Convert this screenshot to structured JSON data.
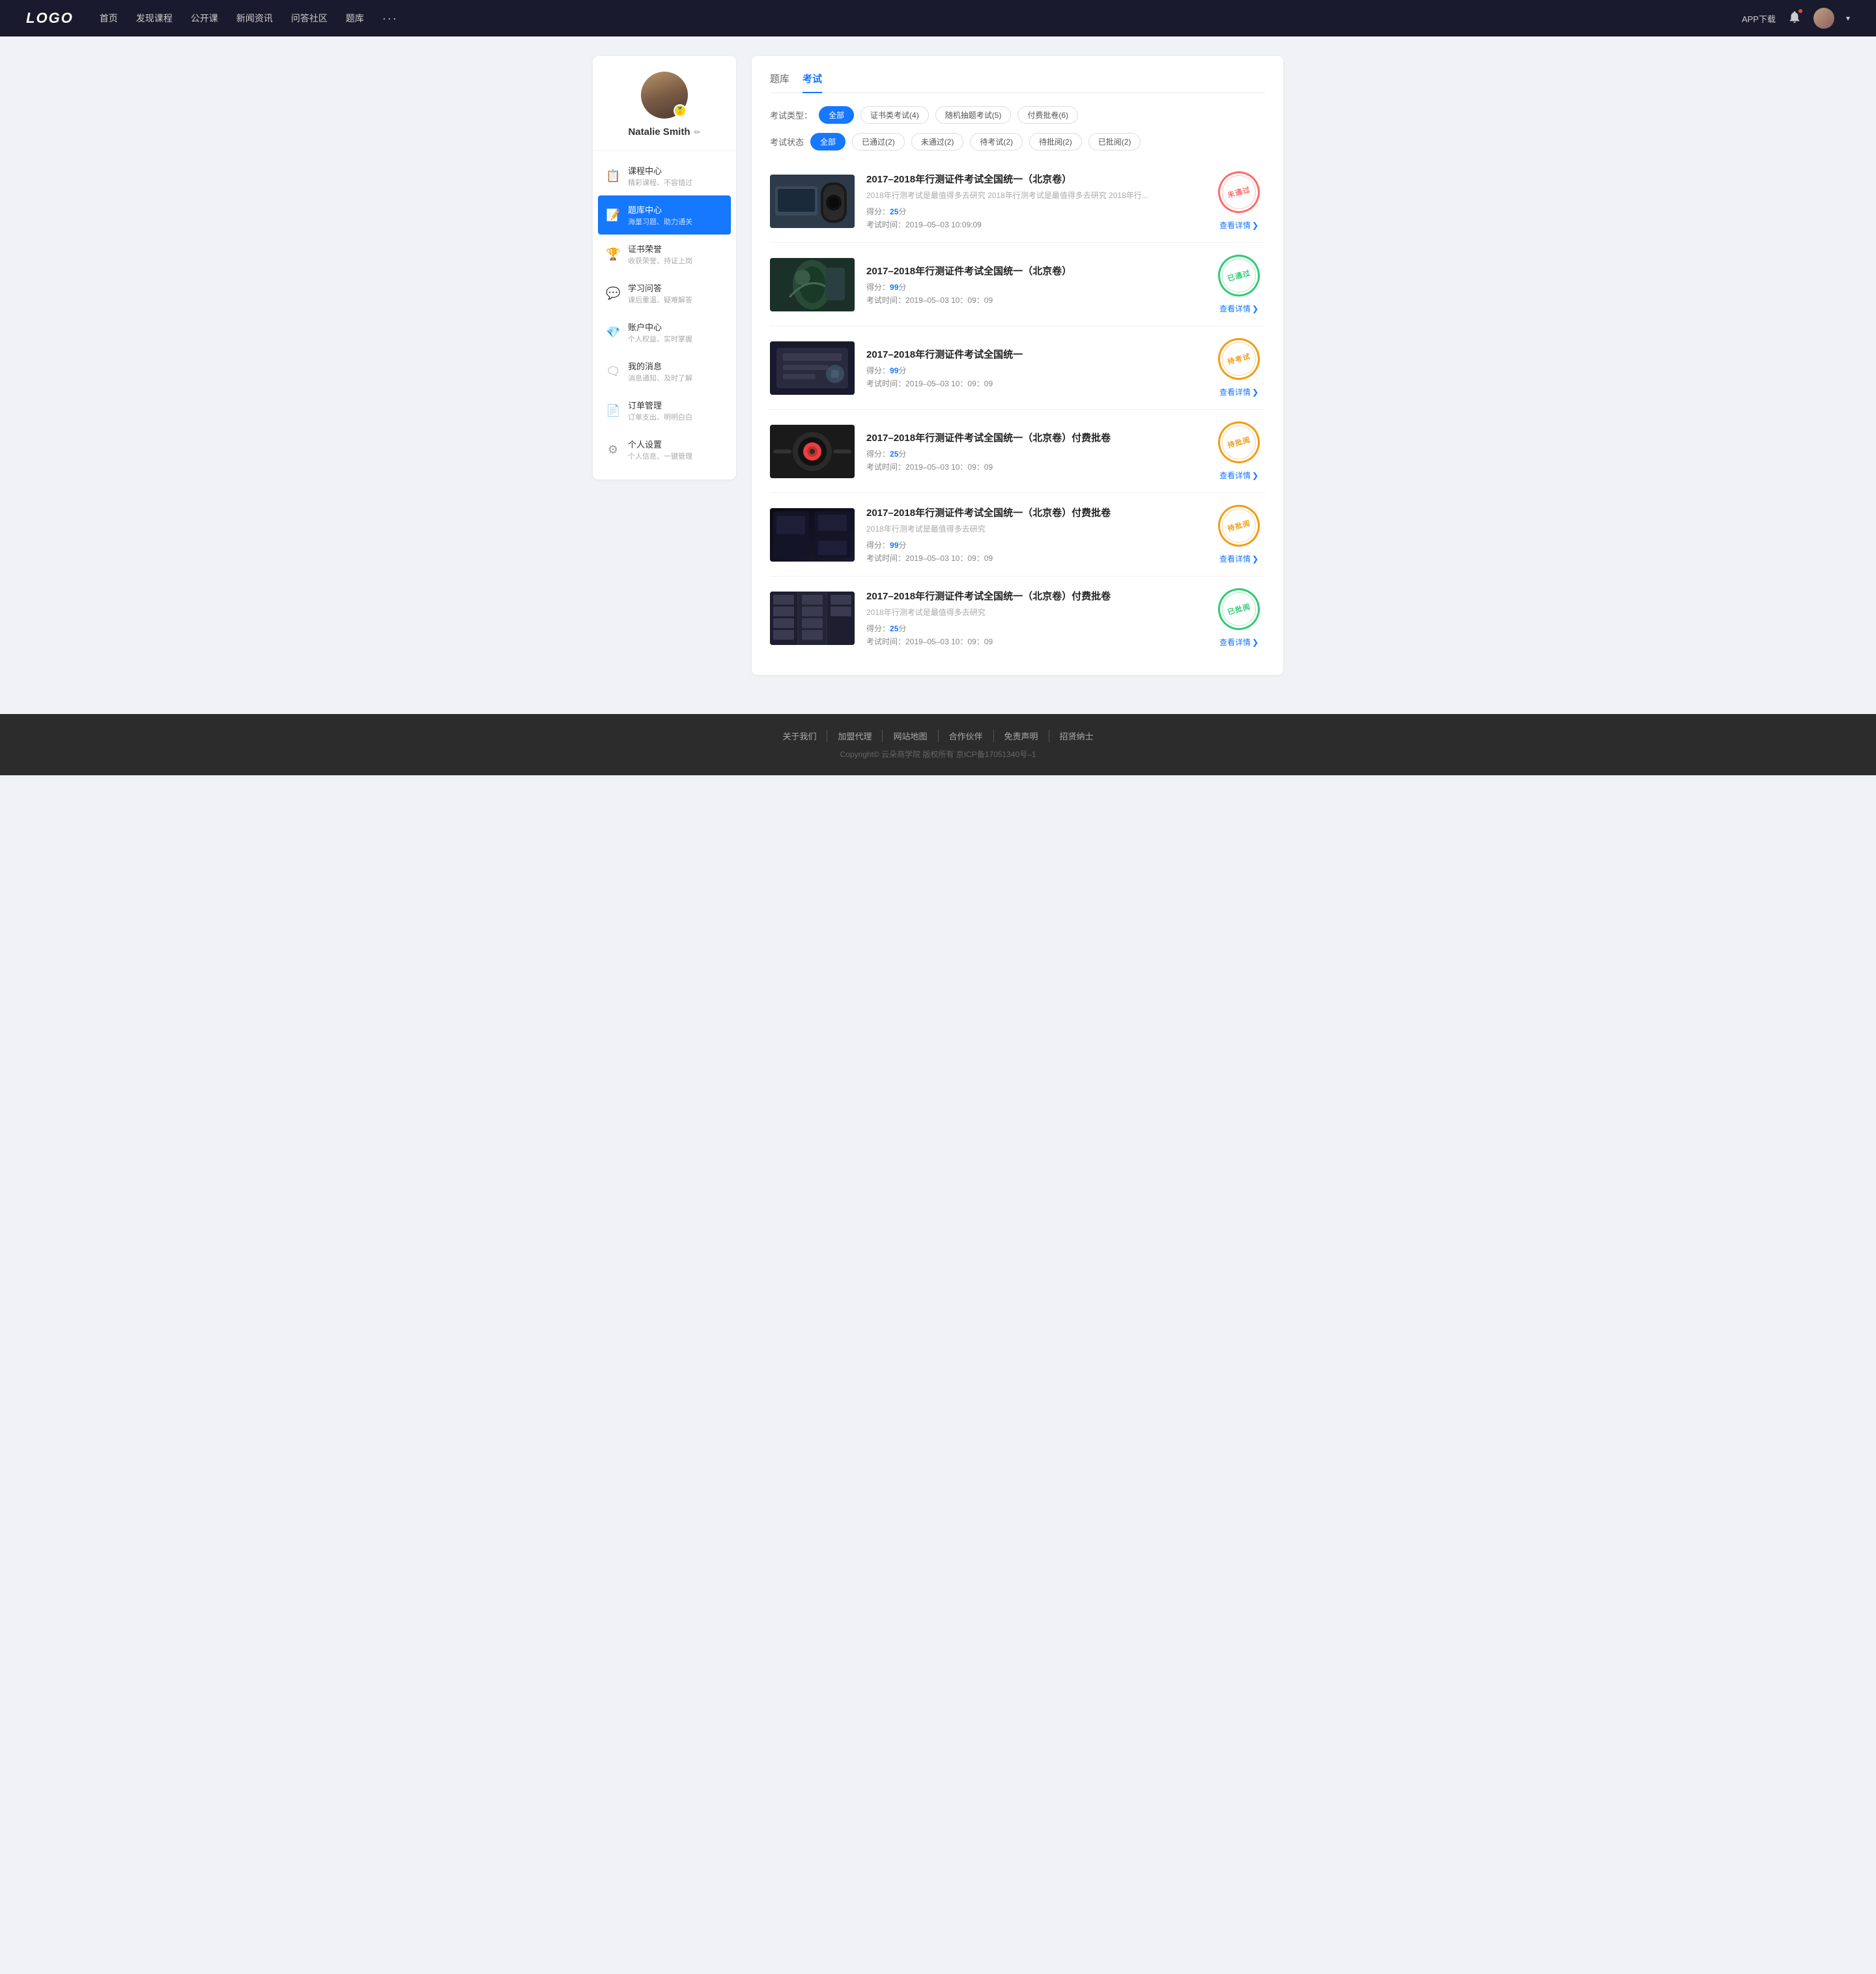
{
  "navbar": {
    "logo": "LOGO",
    "nav_items": [
      {
        "label": "首页",
        "key": "home"
      },
      {
        "label": "发现课程",
        "key": "discover"
      },
      {
        "label": "公开课",
        "key": "public"
      },
      {
        "label": "新闻资讯",
        "key": "news"
      },
      {
        "label": "问答社区",
        "key": "qa"
      },
      {
        "label": "题库",
        "key": "bank"
      },
      {
        "label": "···",
        "key": "more"
      }
    ],
    "app_download": "APP下载"
  },
  "sidebar": {
    "profile": {
      "name": "Natalie Smith",
      "badge": "🏅"
    },
    "menu_items": [
      {
        "key": "course",
        "icon": "📋",
        "title": "课程中心",
        "subtitle": "精彩课程、不容错过",
        "active": false
      },
      {
        "key": "bank",
        "icon": "📝",
        "title": "题库中心",
        "subtitle": "海量习题、助力通关",
        "active": true
      },
      {
        "key": "cert",
        "icon": "🏆",
        "title": "证书荣誉",
        "subtitle": "收获荣誉、持证上岗",
        "active": false
      },
      {
        "key": "qa",
        "icon": "💬",
        "title": "学习问答",
        "subtitle": "课后重温、疑难解答",
        "active": false
      },
      {
        "key": "account",
        "icon": "💎",
        "title": "账户中心",
        "subtitle": "个人权益、实时掌握",
        "active": false
      },
      {
        "key": "message",
        "icon": "🗨",
        "title": "我的消息",
        "subtitle": "消息通知、及时了解",
        "active": false
      },
      {
        "key": "order",
        "icon": "📄",
        "title": "订单管理",
        "subtitle": "订单支出、明明白白",
        "active": false
      },
      {
        "key": "settings",
        "icon": "⚙",
        "title": "个人设置",
        "subtitle": "个人信息、一键管理",
        "active": false
      }
    ]
  },
  "main": {
    "top_tabs": [
      {
        "label": "题库",
        "key": "bank",
        "active": false
      },
      {
        "label": "考试",
        "key": "exam",
        "active": true
      }
    ],
    "type_filter": {
      "label": "考试类型：",
      "options": [
        {
          "label": "全部",
          "key": "all",
          "active": true
        },
        {
          "label": "证书类考试(4)",
          "key": "cert",
          "active": false
        },
        {
          "label": "随机抽题考试(5)",
          "key": "random",
          "active": false
        },
        {
          "label": "付费批卷(6)",
          "key": "paid",
          "active": false
        }
      ]
    },
    "status_filter": {
      "label": "考试状态",
      "options": [
        {
          "label": "全部",
          "key": "all",
          "active": true
        },
        {
          "label": "已通过(2)",
          "key": "passed",
          "active": false
        },
        {
          "label": "未通过(2)",
          "key": "failed",
          "active": false
        },
        {
          "label": "待考试(2)",
          "key": "pending",
          "active": false
        },
        {
          "label": "待批阅(2)",
          "key": "review",
          "active": false
        },
        {
          "label": "已批阅(2)",
          "key": "reviewed",
          "active": false
        }
      ]
    },
    "exam_items": [
      {
        "id": 1,
        "title": "2017–2018年行测证件考试全国统一（北京卷）",
        "desc": "2018年行测考试是最值得多去研究 2018年行测考试是最值得多去研究 2018年行...",
        "score_label": "得分：",
        "score": "25",
        "score_suffix": "分",
        "time_label": "考试时间：",
        "time": "2019–05–03  10:09:09",
        "status": "not_passed",
        "status_text": "未通过",
        "view_label": "查看详情",
        "thumb_class": "thumb-1"
      },
      {
        "id": 2,
        "title": "2017–2018年行测证件考试全国统一（北京卷）",
        "desc": "",
        "score_label": "得分：",
        "score": "99",
        "score_suffix": "分",
        "time_label": "考试时间：",
        "time": "2019–05–03  10：09：09",
        "status": "passed",
        "status_text": "已通过",
        "view_label": "查看详情",
        "thumb_class": "thumb-2"
      },
      {
        "id": 3,
        "title": "2017–2018年行测证件考试全国统一",
        "desc": "",
        "score_label": "得分：",
        "score": "99",
        "score_suffix": "分",
        "time_label": "考试时间：",
        "time": "2019–05–03  10：09：09",
        "status": "pending",
        "status_text": "待考试",
        "view_label": "查看详情",
        "thumb_class": "thumb-3"
      },
      {
        "id": 4,
        "title": "2017–2018年行测证件考试全国统一（北京卷）付费批卷",
        "desc": "",
        "score_label": "得分：",
        "score": "25",
        "score_suffix": "分",
        "time_label": "考试时间：",
        "time": "2019–05–03  10：09：09",
        "status": "review",
        "status_text": "待批阅",
        "view_label": "查看详情",
        "thumb_class": "thumb-4"
      },
      {
        "id": 5,
        "title": "2017–2018年行测证件考试全国统一（北京卷）付费批卷",
        "desc": "2018年行测考试是最值得多去研究",
        "score_label": "得分：",
        "score": "99",
        "score_suffix": "分",
        "time_label": "考试时间：",
        "time": "2019–05–03  10：09：09",
        "status": "review",
        "status_text": "待批阅",
        "view_label": "查看详情",
        "thumb_class": "thumb-5"
      },
      {
        "id": 6,
        "title": "2017–2018年行测证件考试全国统一（北京卷）付费批卷",
        "desc": "2018年行测考试是最值得多去研究",
        "score_label": "得分：",
        "score": "25",
        "score_suffix": "分",
        "time_label": "考试时间：",
        "time": "2019–05–03  10：09：09",
        "status": "reviewed",
        "status_text": "已批阅",
        "view_label": "查看详情",
        "thumb_class": "thumb-6"
      }
    ]
  },
  "footer": {
    "links": [
      {
        "label": "关于我们"
      },
      {
        "label": "加盟代理"
      },
      {
        "label": "网站地图"
      },
      {
        "label": "合作伙伴"
      },
      {
        "label": "免责声明"
      },
      {
        "label": "招贤纳士"
      }
    ],
    "copyright": "Copyright© 云朵商学院  版权所有    京ICP备17051340号–1"
  }
}
